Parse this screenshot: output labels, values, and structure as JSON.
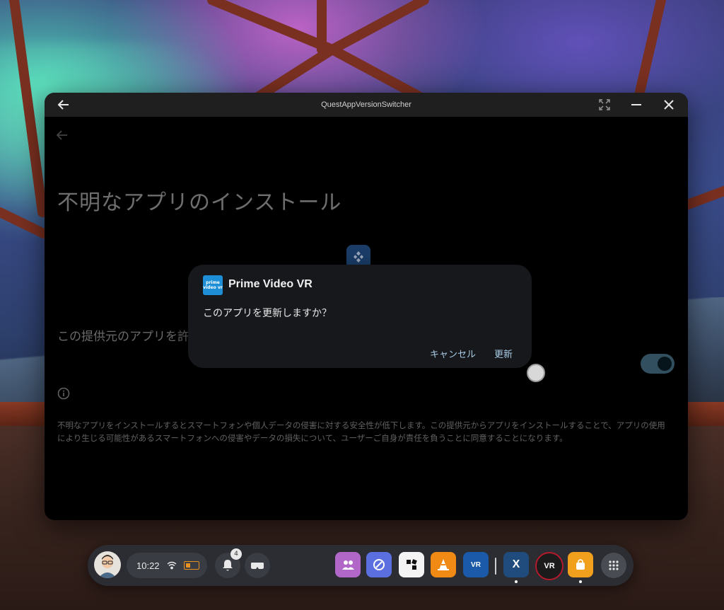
{
  "window": {
    "title": "QuestAppVersionSwitcher"
  },
  "page": {
    "title": "不明なアプリのインストール",
    "setting_label": "この提供元のアプリを許",
    "warning_text": "不明なアプリをインストールするとスマートフォンや個人データの侵害に対する安全性が低下します。この提供元からアプリをインストールすることで、アプリの使用により生じる可能性があるスマートフォンへの侵害やデータの損失について、ユーザーご自身が責任を負うことに同意することになります。",
    "toggle_on": true
  },
  "dialog": {
    "app_name": "Prime Video VR",
    "icon_text": "prime video vr",
    "message": "このアプリを更新しますか？",
    "cancel_label": "キャンセル",
    "confirm_label": "更新"
  },
  "dock": {
    "time": "10:22",
    "notification_count": "4",
    "apps": [
      {
        "name": "people-app",
        "color": "#b067c8"
      },
      {
        "name": "browser-app",
        "color": "#5b6fe0"
      },
      {
        "name": "puzzle-app",
        "color": "#f4f4f4"
      },
      {
        "name": "vlc-app",
        "color": "#f08a14"
      },
      {
        "name": "vr-news-app",
        "color": "#1a5aa8",
        "label": "VR"
      },
      {
        "name": "quest-app-version-switcher-app",
        "color": "#1f4c7c",
        "label": "X"
      },
      {
        "name": "world-vr-station-app",
        "color": "#1b1b1b",
        "label": "VR"
      },
      {
        "name": "store-app",
        "color": "#f0a01c"
      }
    ]
  },
  "colors": {
    "accent": "#a9cde6",
    "toggle_track": "#6aa6c8",
    "dialog_bg": "#17181c"
  }
}
